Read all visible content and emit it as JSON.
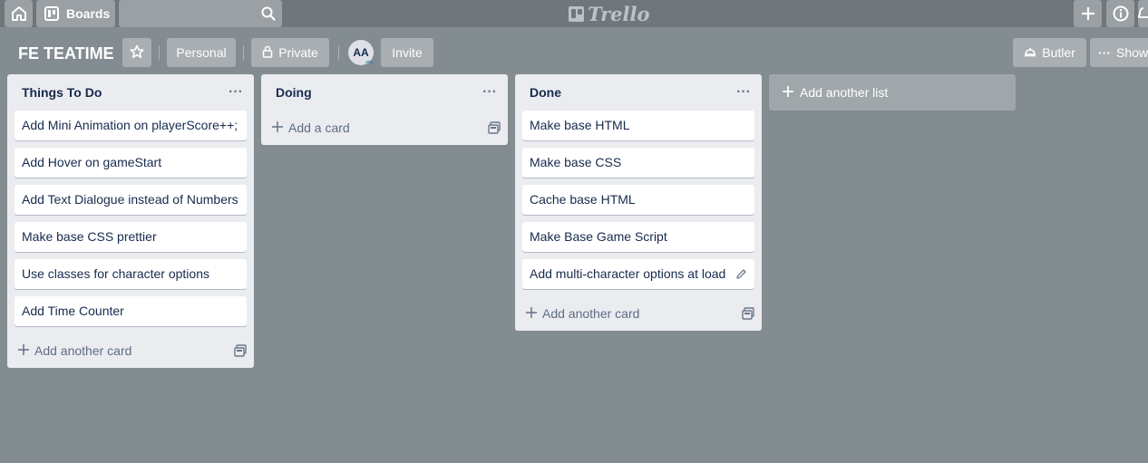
{
  "header": {
    "boards_label": "Boards",
    "logo_text": "Trello",
    "icons": [
      "home-icon",
      "boards-icon",
      "search-icon",
      "plus-icon",
      "info-icon",
      "bell-icon"
    ]
  },
  "board": {
    "title": "FE TEATIME",
    "personal_label": "Personal",
    "private_label": "Private",
    "avatar_initials": "AA",
    "invite_label": "Invite",
    "butler_label": "Butler",
    "show_menu_label": "Show Menu"
  },
  "lists": [
    {
      "title": "Things To Do",
      "menu": "···",
      "cards": [
        "Add Mini Animation on playerScore++;",
        "Add Hover on gameStart",
        "Add Text Dialogue instead of Numbers",
        "Make base CSS prettier",
        "Use classes for character options",
        "Add Time Counter"
      ],
      "add_label": "Add another card"
    },
    {
      "title": "Doing",
      "menu": "···",
      "cards": [],
      "add_label": "Add a card"
    },
    {
      "title": "Done",
      "menu": "···",
      "cards": [
        "Make base HTML",
        "Make base CSS",
        "Cache base HTML",
        "Make Base Game Script",
        "Add multi-character options at load"
      ],
      "add_label": "Add another card"
    }
  ],
  "add_list_label": "Add another list",
  "colors": {
    "background": "#838c91",
    "header": "#6f777c",
    "list": "#ebecf0",
    "card": "#ffffff",
    "text": "#172b4d"
  }
}
